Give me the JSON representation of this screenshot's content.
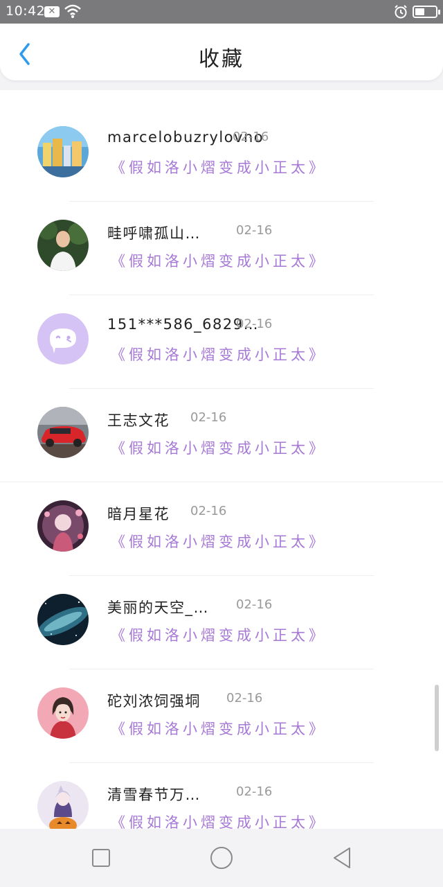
{
  "status_bar": {
    "time": "10:42",
    "battery_level": 0.45
  },
  "header": {
    "title": "收藏"
  },
  "items": [
    {
      "name": "marcelobuzrylovno",
      "date": "02-16",
      "quote": "《假如洛小熠变成小正太》",
      "avatar_icon": "city-photo-avatar"
    },
    {
      "name": "畦呼啸孤山…",
      "date": "02-16",
      "quote": "《假如洛小熠变成小正太》",
      "avatar_icon": "man-photo-avatar"
    },
    {
      "name": "151***586_6829…",
      "date": "02-16",
      "quote": "《假如洛小熠变成小正太》",
      "avatar_icon": "default-chat-avatar"
    },
    {
      "name": "王志文花",
      "date": "02-16",
      "quote": "《假如洛小熠变成小正太》",
      "avatar_icon": "red-car-avatar"
    },
    {
      "name": "暗月星花",
      "date": "02-16",
      "quote": "《假如洛小熠变成小正太》",
      "avatar_icon": "anime-girl-avatar"
    },
    {
      "name": "美丽的天空_…",
      "date": "02-16",
      "quote": "《假如洛小熠变成小正太》",
      "avatar_icon": "galaxy-avatar"
    },
    {
      "name": "砣刘浓饲强垌",
      "date": "02-16",
      "quote": "《假如洛小熠变成小正太》",
      "avatar_icon": "cartoon-girl-avatar"
    },
    {
      "name": "清雪春节万…",
      "date": "02-16",
      "quote": "《假如洛小熠变成小正太》",
      "avatar_icon": "halloween-anime-avatar"
    }
  ],
  "colors": {
    "accent_blue": "#2e9bef",
    "quote_purple": "#a779d6",
    "status_bar": "#7a7a7c"
  }
}
